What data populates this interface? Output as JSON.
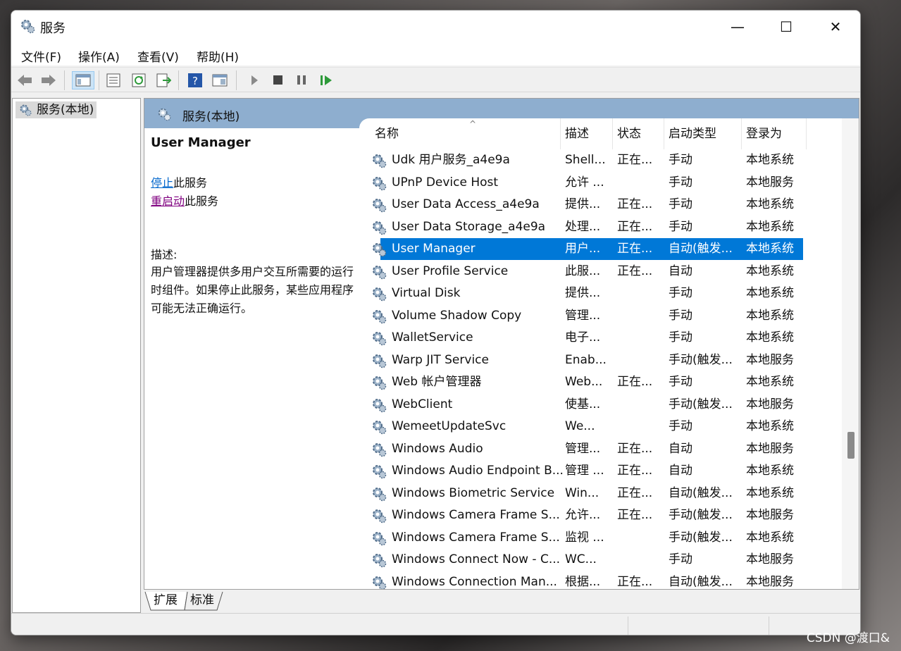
{
  "window": {
    "title": "服务",
    "controls": {
      "minimize": "—",
      "maximize": "☐",
      "close": "✕"
    }
  },
  "menu": {
    "items": [
      "文件(F)",
      "操作(A)",
      "查看(V)",
      "帮助(H)"
    ]
  },
  "toolbar": {
    "buttons": [
      "back-icon",
      "forward-icon",
      "console-tree-icon",
      "properties-icon",
      "refresh-icon",
      "export-list-icon",
      "help-icon",
      "view-icon",
      "start-service-icon",
      "stop-service-icon",
      "pause-service-icon",
      "resume-service-icon"
    ]
  },
  "tree": {
    "root_label": "服务(本地)"
  },
  "content": {
    "header_title": "服务(本地)",
    "selected_service": "User Manager",
    "stop_link": "停止",
    "stop_suffix": "此服务",
    "restart_link": "重启动",
    "restart_suffix": "此服务",
    "description_label": "描述:",
    "description_text": "用户管理器提供多用户交互所需要的运行时组件。如果停止此服务，某些应用程序可能无法正确运行。"
  },
  "table": {
    "columns": [
      "名称",
      "描述",
      "状态",
      "启动类型",
      "登录为"
    ],
    "sort_indicator": "^",
    "rows": [
      {
        "name": "Udk 用户服务_a4e9a",
        "desc": "Shell...",
        "status": "正在...",
        "startup": "手动",
        "logon": "本地系统",
        "selected": false
      },
      {
        "name": "UPnP Device Host",
        "desc": "允许 ...",
        "status": "",
        "startup": "手动",
        "logon": "本地服务",
        "selected": false
      },
      {
        "name": "User Data Access_a4e9a",
        "desc": "提供...",
        "status": "正在...",
        "startup": "手动",
        "logon": "本地系统",
        "selected": false
      },
      {
        "name": "User Data Storage_a4e9a",
        "desc": "处理...",
        "status": "正在...",
        "startup": "手动",
        "logon": "本地系统",
        "selected": false
      },
      {
        "name": "User Manager",
        "desc": "用户...",
        "status": "正在...",
        "startup": "自动(触发...",
        "logon": "本地系统",
        "selected": true
      },
      {
        "name": "User Profile Service",
        "desc": "此服...",
        "status": "正在...",
        "startup": "自动",
        "logon": "本地系统",
        "selected": false
      },
      {
        "name": "Virtual Disk",
        "desc": "提供...",
        "status": "",
        "startup": "手动",
        "logon": "本地系统",
        "selected": false
      },
      {
        "name": "Volume Shadow Copy",
        "desc": "管理...",
        "status": "",
        "startup": "手动",
        "logon": "本地系统",
        "selected": false
      },
      {
        "name": "WalletService",
        "desc": "电子...",
        "status": "",
        "startup": "手动",
        "logon": "本地系统",
        "selected": false
      },
      {
        "name": "Warp JIT Service",
        "desc": "Enab...",
        "status": "",
        "startup": "手动(触发...",
        "logon": "本地服务",
        "selected": false
      },
      {
        "name": "Web 帐户管理器",
        "desc": "Web...",
        "status": "正在...",
        "startup": "手动",
        "logon": "本地系统",
        "selected": false
      },
      {
        "name": "WebClient",
        "desc": "使基...",
        "status": "",
        "startup": "手动(触发...",
        "logon": "本地服务",
        "selected": false
      },
      {
        "name": "WemeetUpdateSvc",
        "desc": "We...",
        "status": "",
        "startup": "手动",
        "logon": "本地系统",
        "selected": false
      },
      {
        "name": "Windows Audio",
        "desc": "管理...",
        "status": "正在...",
        "startup": "自动",
        "logon": "本地服务",
        "selected": false
      },
      {
        "name": "Windows Audio Endpoint B...",
        "desc": "管理 ...",
        "status": "正在...",
        "startup": "自动",
        "logon": "本地系统",
        "selected": false
      },
      {
        "name": "Windows Biometric Service",
        "desc": "Win...",
        "status": "正在...",
        "startup": "自动(触发...",
        "logon": "本地系统",
        "selected": false
      },
      {
        "name": "Windows Camera Frame S...",
        "desc": "允许...",
        "status": "正在...",
        "startup": "手动(触发...",
        "logon": "本地服务",
        "selected": false
      },
      {
        "name": "Windows Camera Frame S...",
        "desc": "监视 ...",
        "status": "",
        "startup": "手动(触发...",
        "logon": "本地系统",
        "selected": false
      },
      {
        "name": "Windows Connect Now - C...",
        "desc": "WC...",
        "status": "",
        "startup": "手动",
        "logon": "本地服务",
        "selected": false
      },
      {
        "name": "Windows Connection Man...",
        "desc": "根据...",
        "status": "正在...",
        "startup": "自动(触发...",
        "logon": "本地服务",
        "selected": false
      }
    ]
  },
  "tabs": {
    "extended": "扩展",
    "standard": "标准"
  },
  "watermark": "CSDN @渡口&",
  "colors": {
    "selection": "#0078d7",
    "header": "#8eaecf",
    "link": "#0066cc",
    "visited_link": "#800080"
  }
}
